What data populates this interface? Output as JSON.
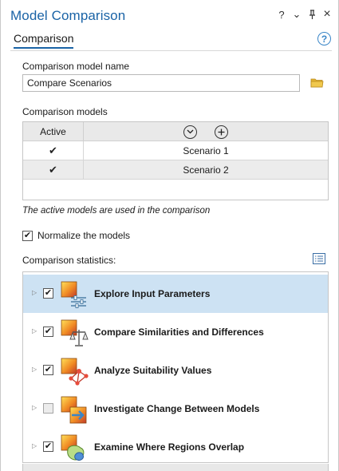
{
  "window": {
    "title": "Model Comparison",
    "controls": [
      "?",
      "⌄",
      "⊥",
      "×"
    ]
  },
  "tabs": [
    {
      "label": "Comparison",
      "active": true
    }
  ],
  "form": {
    "name_label": "Comparison model name",
    "name_value": "Compare Scenarios",
    "models_label": "Comparison models",
    "models_header": {
      "active": "Active"
    },
    "models": [
      {
        "name": "Scenario 1",
        "active": true
      },
      {
        "name": "Scenario 2",
        "active": true
      }
    ],
    "models_note": "The active models are used in the comparison",
    "normalize": {
      "label": "Normalize the models",
      "checked": true
    },
    "stats_label": "Comparison statistics:",
    "statistics": [
      {
        "label": "Explore Input Parameters",
        "checked": true,
        "selected": true,
        "icon": "sliders-icon"
      },
      {
        "label": "Compare Similarities and Differences",
        "checked": true,
        "selected": false,
        "icon": "balance-scale-icon"
      },
      {
        "label": "Analyze Suitability Values",
        "checked": true,
        "selected": false,
        "icon": "network-icon"
      },
      {
        "label": "Investigate Change Between Models",
        "checked": false,
        "selected": false,
        "icon": "change-arrow-icon"
      },
      {
        "label": "Examine Where Regions Overlap",
        "checked": true,
        "selected": false,
        "icon": "overlap-regions-icon"
      }
    ]
  },
  "colors": {
    "accent": "#1a63a6",
    "selected_row": "#cde2f3",
    "folder": "#e3b330"
  }
}
